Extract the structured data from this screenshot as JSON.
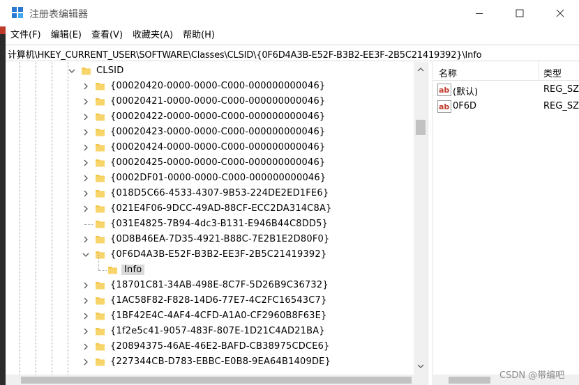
{
  "window": {
    "title": "注册表编辑器",
    "controls": [
      "minimize-icon",
      "maximize-icon",
      "close-icon"
    ]
  },
  "menu": [
    "文件(F)",
    "编辑(E)",
    "查看(V)",
    "收藏夹(A)",
    "帮助(H)"
  ],
  "address": "计算机\\HKEY_CURRENT_USER\\SOFTWARE\\Classes\\CLSID\\{0F6D4A3B-E52F-B3B2-EE3F-2B5C21419392}\\Info",
  "tree": {
    "root": {
      "label": "CLSID",
      "expanded": true
    },
    "items": [
      {
        "label": "{00020420-0000-0000-C000-000000000046}",
        "has_children": true
      },
      {
        "label": "{00020421-0000-0000-C000-000000000046}",
        "has_children": true
      },
      {
        "label": "{00020422-0000-0000-C000-000000000046}",
        "has_children": true
      },
      {
        "label": "{00020423-0000-0000-C000-000000000046}",
        "has_children": true
      },
      {
        "label": "{00020424-0000-0000-C000-000000000046}",
        "has_children": true
      },
      {
        "label": "{00020425-0000-0000-C000-000000000046}",
        "has_children": true
      },
      {
        "label": "{0002DF01-0000-0000-C000-000000000046}",
        "has_children": true
      },
      {
        "label": "{018D5C66-4533-4307-9B53-224DE2ED1FE6}",
        "has_children": true
      },
      {
        "label": "{021E4F06-9DCC-49AD-88CF-ECC2DA314C8A}",
        "has_children": true
      },
      {
        "label": "{031E4825-7B94-4dc3-B131-E946B44C8DD5}",
        "has_children": false
      },
      {
        "label": "{0D8B46EA-7D35-4921-B88C-7E2B1E2D80F0}",
        "has_children": true
      },
      {
        "label": "{0F6D4A3B-E52F-B3B2-EE3F-2B5C21419392}",
        "has_children": true,
        "expanded": true
      },
      {
        "label": "Info",
        "child": true,
        "selected": true
      },
      {
        "label": "{18701C81-34AB-498E-8C7F-5D26B9C36732}",
        "has_children": true
      },
      {
        "label": "{1AC58F82-F828-14D6-77E7-4C2FC16543C7}",
        "has_children": true
      },
      {
        "label": "{1BF42E4C-4AF4-4CFD-A1A0-CF2960B8F63E}",
        "has_children": true
      },
      {
        "label": "{1f2e5c41-9057-483F-807E-1D21C4AD21BA}",
        "has_children": true
      },
      {
        "label": "{20894375-46AE-46E2-BAFD-CB38975CDCE6}",
        "has_children": true
      },
      {
        "label": "{227344CB-D783-EBBC-E0B8-9EA64B1409DE}",
        "has_children": true
      }
    ]
  },
  "values": {
    "columns": [
      "名称",
      "类型"
    ],
    "rows": [
      {
        "name": "(默认)",
        "type": "REG_SZ",
        "icon": "string-value-icon"
      },
      {
        "name": "0F6D",
        "type": "REG_SZ",
        "icon": "string-value-icon"
      }
    ]
  },
  "watermark": "CSDN @带编吧",
  "colors": {
    "folder": "#f3c64a",
    "selection": "#d9d9d9",
    "string_icon_red": "#c0392b"
  }
}
